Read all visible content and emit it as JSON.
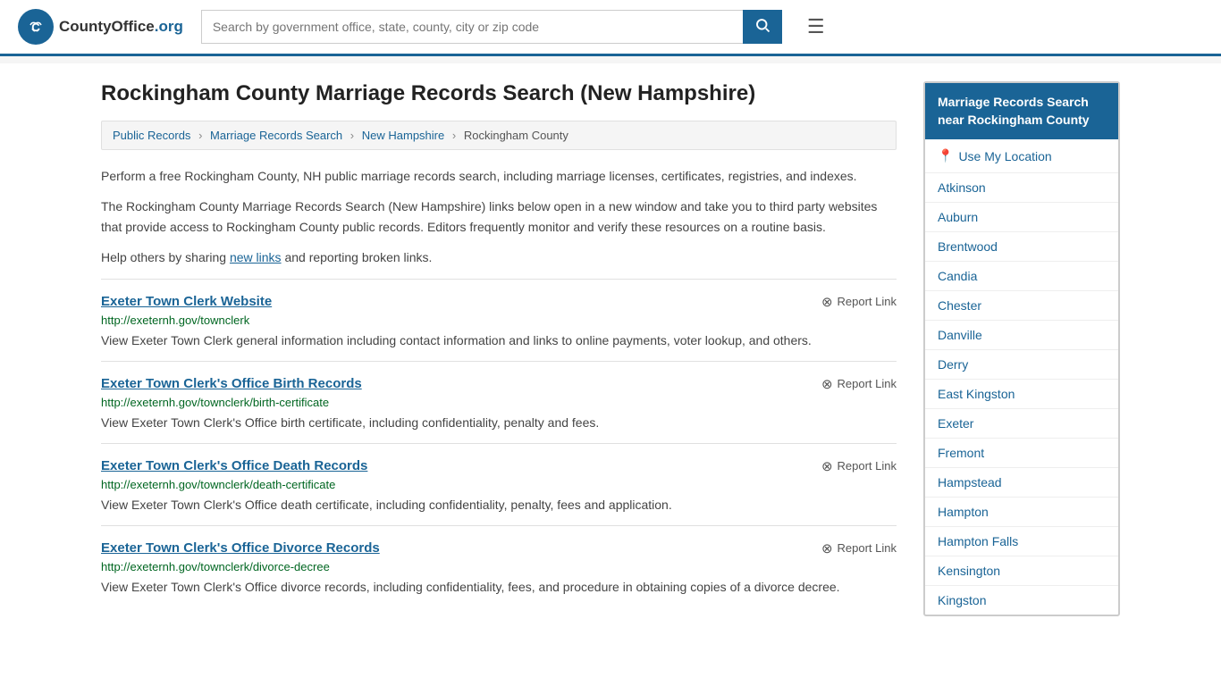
{
  "header": {
    "logo_text": "CountyOffice",
    "logo_org": ".org",
    "search_placeholder": "Search by government office, state, county, city or zip code",
    "search_value": ""
  },
  "page": {
    "title": "Rockingham County Marriage Records Search (New Hampshire)"
  },
  "breadcrumb": {
    "items": [
      {
        "label": "Public Records",
        "href": "#"
      },
      {
        "label": "Marriage Records Search",
        "href": "#"
      },
      {
        "label": "New Hampshire",
        "href": "#"
      },
      {
        "label": "Rockingham County",
        "href": "#",
        "current": true
      }
    ]
  },
  "description": {
    "para1": "Perform a free Rockingham County, NH public marriage records search, including marriage licenses, certificates, registries, and indexes.",
    "para2": "The Rockingham County Marriage Records Search (New Hampshire) links below open in a new window and take you to third party websites that provide access to Rockingham County public records. Editors frequently monitor and verify these resources on a routine basis.",
    "para3_before": "Help others by sharing ",
    "para3_link": "new links",
    "para3_after": " and reporting broken links."
  },
  "results": [
    {
      "title": "Exeter Town Clerk Website",
      "url": "http://exeternh.gov/townclerk",
      "desc": "View Exeter Town Clerk general information including contact information and links to online payments, voter lookup, and others.",
      "report_label": "Report Link"
    },
    {
      "title": "Exeter Town Clerk's Office Birth Records",
      "url": "http://exeternh.gov/townclerk/birth-certificate",
      "desc": "View Exeter Town Clerk's Office birth certificate, including confidentiality, penalty and fees.",
      "report_label": "Report Link"
    },
    {
      "title": "Exeter Town Clerk's Office Death Records",
      "url": "http://exeternh.gov/townclerk/death-certificate",
      "desc": "View Exeter Town Clerk's Office death certificate, including confidentiality, penalty, fees and application.",
      "report_label": "Report Link"
    },
    {
      "title": "Exeter Town Clerk's Office Divorce Records",
      "url": "http://exeternh.gov/townclerk/divorce-decree",
      "desc": "View Exeter Town Clerk's Office divorce records, including confidentiality, fees, and procedure in obtaining copies of a divorce decree.",
      "report_label": "Report Link"
    }
  ],
  "sidebar": {
    "header": "Marriage Records Search near Rockingham County",
    "use_my_location": "Use My Location",
    "locations": [
      {
        "label": "Atkinson",
        "href": "#"
      },
      {
        "label": "Auburn",
        "href": "#"
      },
      {
        "label": "Brentwood",
        "href": "#"
      },
      {
        "label": "Candia",
        "href": "#"
      },
      {
        "label": "Chester",
        "href": "#"
      },
      {
        "label": "Danville",
        "href": "#"
      },
      {
        "label": "Derry",
        "href": "#"
      },
      {
        "label": "East Kingston",
        "href": "#"
      },
      {
        "label": "Exeter",
        "href": "#"
      },
      {
        "label": "Fremont",
        "href": "#"
      },
      {
        "label": "Hampstead",
        "href": "#"
      },
      {
        "label": "Hampton",
        "href": "#"
      },
      {
        "label": "Hampton Falls",
        "href": "#"
      },
      {
        "label": "Kensington",
        "href": "#"
      },
      {
        "label": "Kingston",
        "href": "#"
      }
    ]
  }
}
